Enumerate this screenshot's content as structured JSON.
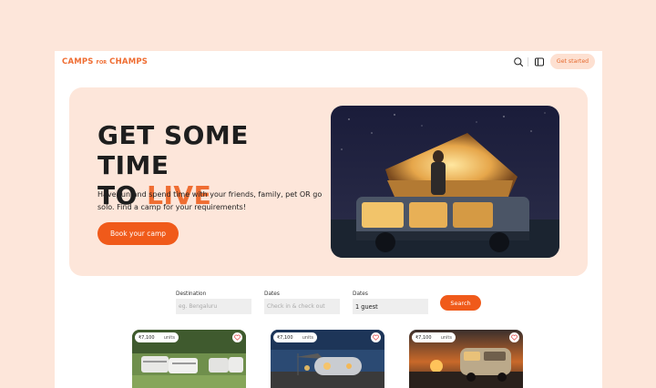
{
  "brand": {
    "word1": "CAMPS",
    "word2": "FOR",
    "word3": "CHAMPS"
  },
  "header": {
    "cta_label": "Get started"
  },
  "hero": {
    "title_line1": "GET SOME TIME",
    "title_line2_prefix": "TO ",
    "title_line2_accent": "LIVE",
    "subtitle": "Have fun and spend time with your friends, family, pet OR go solo. Find a camp for your requirements!",
    "button_label": "Book your camp"
  },
  "search": {
    "fields": [
      {
        "label": "Destination",
        "placeholder": "eg. Bengaluru",
        "value": ""
      },
      {
        "label": "Dates",
        "placeholder": "Check in & check out",
        "value": ""
      },
      {
        "label": "Dates",
        "placeholder": "",
        "value": "1 guest"
      }
    ],
    "button_label": "Search"
  },
  "listings": [
    {
      "price": "₹7,100",
      "units": "units"
    },
    {
      "price": "₹7,100",
      "units": "units"
    },
    {
      "price": "₹7,100",
      "units": "units"
    }
  ],
  "colors": {
    "accent": "#ef6d32",
    "button": "#f05a1a",
    "background": "#fde6da"
  }
}
